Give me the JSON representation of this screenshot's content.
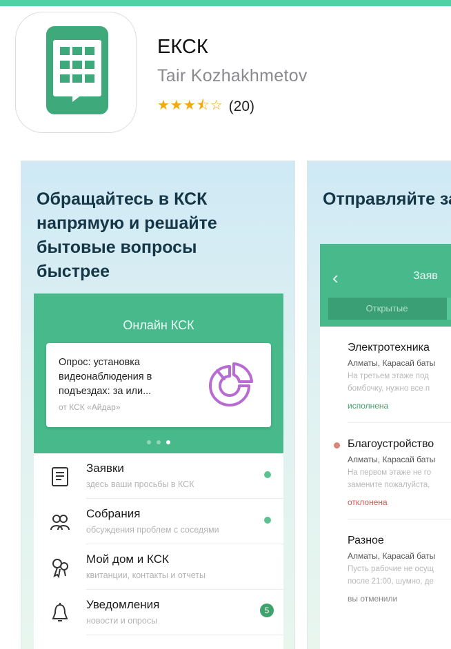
{
  "app": {
    "name": "ЕКСК",
    "developer": "Tair Kozhakhmetov",
    "stars": "★★★⯪☆",
    "rating_count": "(20)"
  },
  "shot1": {
    "headline": "Обращайтесь в КСК напрямую и решайте бытовые вопросы быстрее",
    "card_title": "Онлайн КСК",
    "poll": {
      "question": "Опрос: установка видеонаблюдения в подъездах: за или...",
      "from": "от КСК «Айдар»"
    },
    "menu": [
      {
        "title": "Заявки",
        "subtitle": "здесь ваши просьбы в КСК",
        "indicator": "dot"
      },
      {
        "title": "Собрания",
        "subtitle": "обсуждения проблем с соседями",
        "indicator": "dot"
      },
      {
        "title": "Мой дом и КСК",
        "subtitle": "квитанции, контакты и отчеты",
        "indicator": ""
      },
      {
        "title": "Уведомления",
        "subtitle": "новости и опросы",
        "badge": "5"
      }
    ]
  },
  "shot2": {
    "headline": "Отправляйте за с просьбами в",
    "header_title": "Заяв",
    "tab_open": "Открытые",
    "requests": [
      {
        "title": "Электротехника",
        "address": "Алматы, Карасай баты",
        "desc1": "На третьем этаже под",
        "desc2": "бомбочку, нужно все п",
        "status": "исполнена"
      },
      {
        "title": "Благоустройство",
        "address": "Алматы, Карасай баты",
        "desc1": "На первом этаже не го",
        "desc2": "замените пожалуйста,",
        "status": "отклонена"
      },
      {
        "title": "Разное",
        "address": "Алматы, Карасай баты",
        "desc1": "Пусть рабочие не осущ",
        "desc2": "после 21:00, шумно, де",
        "status": "вы отменили"
      }
    ]
  },
  "colors": {
    "accent_green": "#47b98a",
    "status_done": "#3fa36d",
    "status_rejected": "#d9534f",
    "status_cancelled": "#888888",
    "star": "#f4a80a"
  }
}
